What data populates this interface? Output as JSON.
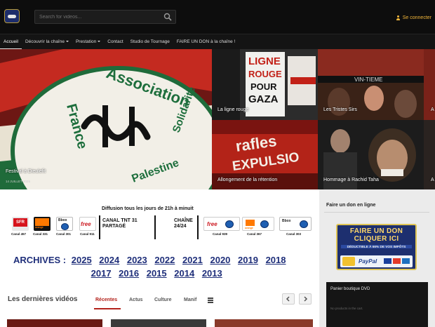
{
  "header": {
    "search_placeholder": "Search for videos...",
    "login_label": "Se connecter"
  },
  "nav": {
    "items": [
      {
        "label": "Accueil",
        "active": true
      },
      {
        "label": "Découvrir la chaîne",
        "dropdown": true
      },
      {
        "label": "Prestation",
        "dropdown": true
      },
      {
        "label": "Contact"
      },
      {
        "label": "Studio de Tournage"
      },
      {
        "label": "FAIRE UN DON à la chaîne !"
      }
    ]
  },
  "hero": {
    "main": {
      "caption": "Festival à Dieulefit",
      "date": "14 JUILLET 2025"
    },
    "tiles": [
      {
        "caption": "La ligne rouge"
      },
      {
        "caption": "Les Tristes Sirs"
      },
      {
        "caption": "A"
      },
      {
        "caption": "Allongement de la rétention"
      },
      {
        "caption": "Hommage à Rachid Taha"
      },
      {
        "caption": "A"
      }
    ]
  },
  "broadcast": {
    "title": "Diffusion tous les jours de 21h à minuit",
    "tnt_label_1": "CANAL TNT 31",
    "tnt_label_2": "PARTAGÉ",
    "chaine_label_1": "CHAÎNE",
    "chaine_label_2": "24/24",
    "channels_left": [
      "Canal 457",
      "Canal 331",
      "Canal 301",
      "Canal 911"
    ],
    "channels_right": [
      "Canal 939",
      "Canal 367",
      "Canal 303"
    ],
    "brands": {
      "sfr": "SFR",
      "orange": "orange",
      "bbox": "Bbox",
      "free": "free"
    }
  },
  "archives": {
    "label": "ARCHIVES :",
    "years": [
      "2025",
      "2024",
      "2023",
      "2022",
      "2021",
      "2020",
      "2019",
      "2018",
      "2017",
      "2016",
      "2015",
      "2014",
      "2013"
    ]
  },
  "latest": {
    "title": "Les dernières vidéos",
    "tabs": [
      "Récentes",
      "Actus",
      "Culture",
      "Manif"
    ]
  },
  "sidebar": {
    "donate_title": "Faire un don en ligne",
    "donate_banner": {
      "line1": "FAIRE UN DON",
      "line2": "CLIQUER ICI",
      "line3": "DÉDUCTIBLE À 66% DE VOS IMPÔTS",
      "paypal": "PayPal"
    },
    "shop_title": "Panier boutique DVD",
    "shop_note": "No products in the cart."
  },
  "colors": {
    "accent_red": "#b3221b",
    "archives_blue": "#1f2f7a",
    "login_gold": "#f2b63a"
  }
}
